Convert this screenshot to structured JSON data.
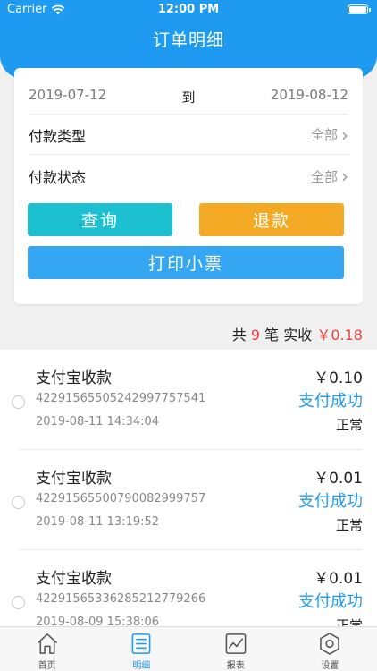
{
  "status_bar": {
    "carrier": "Carrier",
    "time": "12:00 PM"
  },
  "header": {
    "title": "订单明细"
  },
  "filters": {
    "start_date": "2019-07-12",
    "to_label": "到",
    "end_date": "2019-08-12",
    "pay_type_label": "付款类型",
    "pay_type_value": "全部",
    "pay_state_label": "付款状态",
    "pay_state_value": "全部"
  },
  "buttons": {
    "query": "查询",
    "refund": "退款",
    "print": "打印小票"
  },
  "summary": {
    "prefix": "共",
    "count": "9",
    "count_unit": "笔",
    "paid_label": "实收",
    "paid_amount": "￥0.18"
  },
  "orders": [
    {
      "name": "支付宝收款",
      "order_no": "4229156550524299775754​1",
      "time": "2019-08-11 14:34:04",
      "amount": "￥0.10",
      "pay_status": "支付成功",
      "state": "正常"
    },
    {
      "name": "支付宝收款",
      "order_no": "422915655007900829​99757",
      "time": "2019-08-11 13:19:52",
      "amount": "￥0.01",
      "pay_status": "支付成功",
      "state": "正常"
    },
    {
      "name": "支付宝收款",
      "order_no": "4229156533628521277926​6",
      "time": "2019-08-09 15:38:06",
      "amount": "￥0.01",
      "pay_status": "支付成功",
      "state": "正常"
    }
  ],
  "tabs": [
    {
      "label": "首页",
      "icon": "home-icon"
    },
    {
      "label": "明细",
      "icon": "list-icon",
      "active": true
    },
    {
      "label": "报表",
      "icon": "chart-icon"
    },
    {
      "label": "设置",
      "icon": "settings-icon"
    }
  ],
  "colors": {
    "primary": "#1e9bf0",
    "query": "#1cc0d0",
    "refund": "#f3a923",
    "print": "#34a6f2",
    "accent_red": "#f04141"
  }
}
